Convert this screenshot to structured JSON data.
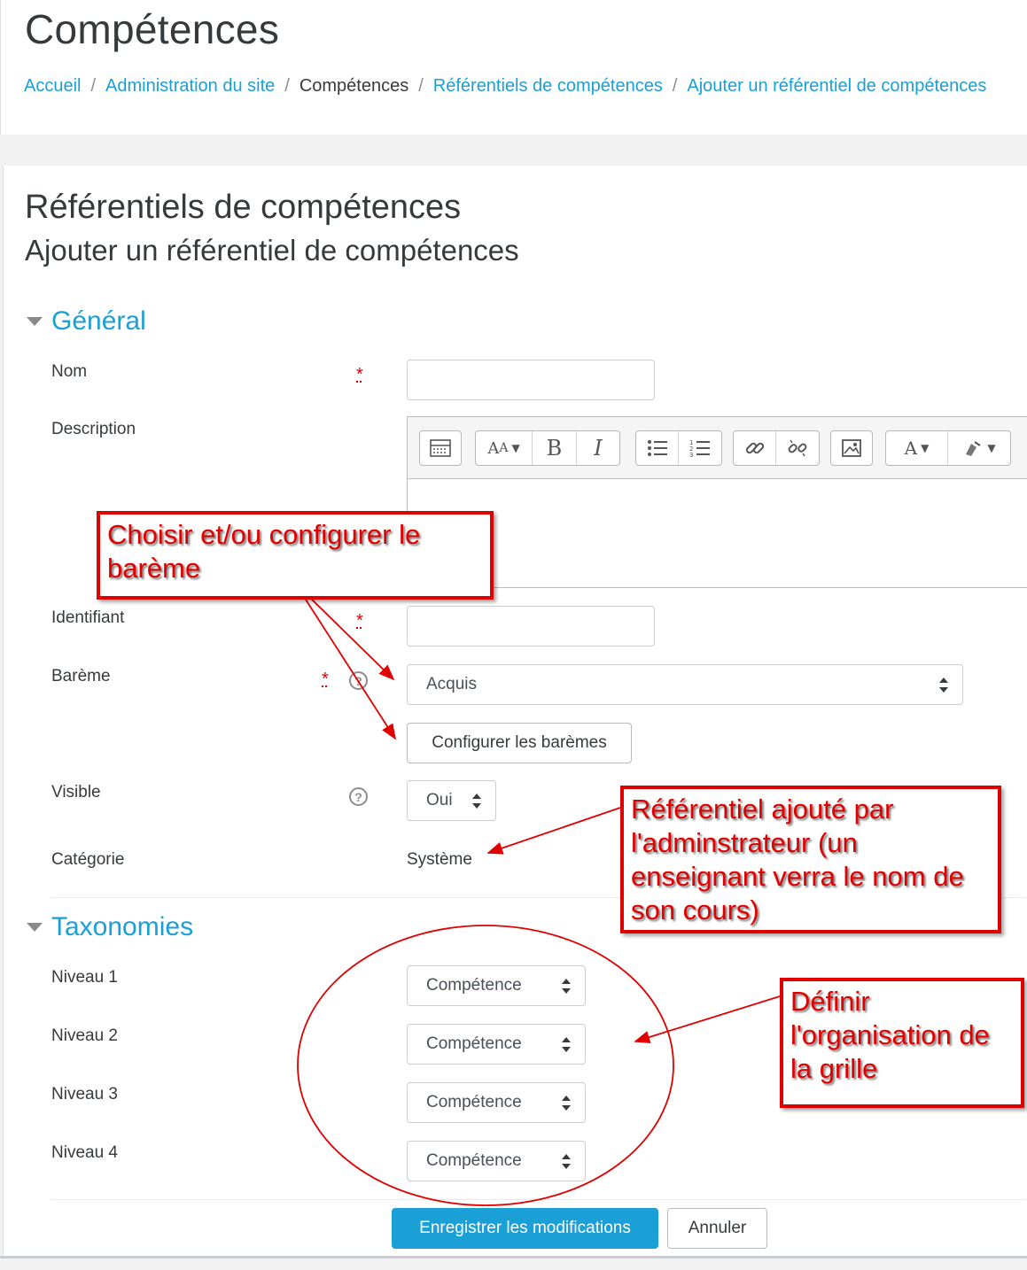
{
  "header": {
    "page_title": "Compétences",
    "breadcrumb": [
      {
        "label": "Accueil",
        "current": false
      },
      {
        "label": "Administration du site",
        "current": false
      },
      {
        "label": "Compétences",
        "current": true
      },
      {
        "label": "Référentiels de compétences",
        "current": false
      },
      {
        "label": "Ajouter un référentiel de compétences",
        "current": false
      }
    ]
  },
  "main": {
    "heading": "Référentiels de compétences",
    "subheading": "Ajouter un référentiel de compétences"
  },
  "general": {
    "section_label": "Général",
    "nom_label": "Nom",
    "nom_value": "",
    "description_label": "Description",
    "identifiant_label": "Identifiant",
    "identifiant_value": "",
    "bareme_label": "Barème",
    "bareme_value": "Acquis",
    "configure_button": "Configurer les barèmes",
    "visible_label": "Visible",
    "visible_value": "Oui",
    "categorie_label": "Catégorie",
    "categorie_value": "Système",
    "required_mark": "*",
    "help_mark": "?"
  },
  "taxonomies": {
    "section_label": "Taxonomies",
    "levels": [
      {
        "label": "Niveau 1",
        "value": "Compétence"
      },
      {
        "label": "Niveau 2",
        "value": "Compétence"
      },
      {
        "label": "Niveau 3",
        "value": "Compétence"
      },
      {
        "label": "Niveau 4",
        "value": "Compétence"
      }
    ]
  },
  "actions": {
    "save": "Enregistrer les modifications",
    "cancel": "Annuler"
  },
  "annotations": {
    "bareme_note": "Choisir et/ou configurer le barème",
    "categorie_note": "Référentiel ajouté par l'adminstrateur (un enseignant verra le nom de son cours)",
    "taxonomy_note": "Définir l'organisation de la grille"
  },
  "colors": {
    "link": "#1a9fd7",
    "primary_button": "#1a9fd7",
    "annotation_red": "#e00000"
  }
}
